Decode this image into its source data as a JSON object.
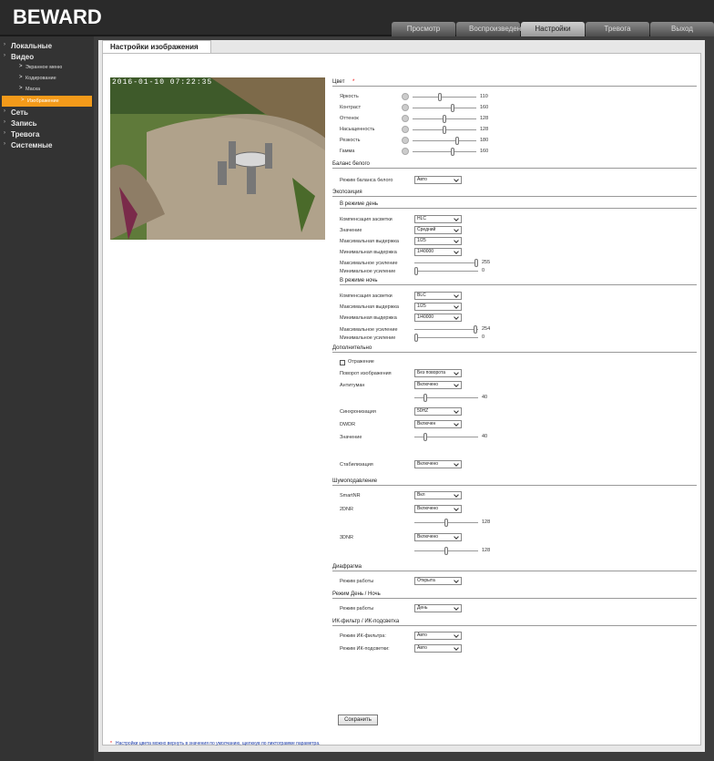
{
  "brand": "BEWARD",
  "tabs": [
    "Просмотр",
    "Воспроизведение",
    "Настройки",
    "Тревога",
    "Выход"
  ],
  "sidebar": [
    {
      "label": "Локальные",
      "level": "top"
    },
    {
      "label": "Видео",
      "level": "top"
    },
    {
      "label": "Экранное меню",
      "level": "sub"
    },
    {
      "label": "Кодирование",
      "level": "sub"
    },
    {
      "label": "Маска",
      "level": "sub"
    },
    {
      "label": "Изображение",
      "level": "sub",
      "selected": true
    },
    {
      "label": "Сеть",
      "level": "top"
    },
    {
      "label": "Запись",
      "level": "top"
    },
    {
      "label": "Тревога",
      "level": "top"
    },
    {
      "label": "Системные",
      "level": "top"
    }
  ],
  "page_tab": "Настройки изображения",
  "camera_timestamp": "2016-01-10 07:22:35",
  "color": {
    "title": "Цвет",
    "req": "*",
    "items": [
      {
        "label": "Яркость",
        "value": "110",
        "pos": 0.43
      },
      {
        "label": "Контраст",
        "value": "160",
        "pos": 0.63
      },
      {
        "label": "Оттенок",
        "value": "128",
        "pos": 0.5
      },
      {
        "label": "Насыщенность",
        "value": "128",
        "pos": 0.5
      },
      {
        "label": "Резкость",
        "value": "180",
        "pos": 0.71
      },
      {
        "label": "Гамма",
        "value": "160",
        "pos": 0.63
      }
    ]
  },
  "wb": {
    "title": "Баланс белого",
    "label": "Режим баланса белого",
    "value": "Авто"
  },
  "exposure": {
    "title": "Экспозиция",
    "day_title": "В режиме день",
    "day": [
      {
        "label": "Компенсация засветки",
        "value": "HLC"
      },
      {
        "label": "Значение",
        "value": "Средний"
      },
      {
        "label": "Максимальная выдержка",
        "value": "1/25"
      },
      {
        "label": "Минимальная выдержка",
        "value": "1/40000"
      }
    ],
    "day_sliders": [
      {
        "label": "Максимальное усиление",
        "value": "255",
        "pos": 1.0
      },
      {
        "label": "Минимальное усиление",
        "value": "0",
        "pos": 0.0
      }
    ],
    "night_title": "В режиме ночь",
    "night": [
      {
        "label": "Компенсация засветки",
        "value": "BLC"
      },
      {
        "label": "Максимальная выдержка",
        "value": "1/25"
      },
      {
        "label": "Минимальная выдержка",
        "value": "1/40000"
      }
    ],
    "night_sliders": [
      {
        "label": "Максимальное усиление",
        "value": "254",
        "pos": 0.99
      },
      {
        "label": "Минимальное усиление",
        "value": "0",
        "pos": 0.0
      }
    ]
  },
  "extra": {
    "title": "Дополнительно",
    "mirror": "Отражение",
    "rotate": {
      "label": "Поворот изображения",
      "value": "Без поворота"
    },
    "antifog": {
      "label": "Антитуман",
      "value": "Включено",
      "slider": "40",
      "pos": 0.15
    },
    "sync": {
      "label": "Синхронизация",
      "value": "50HZ"
    },
    "dwdr": {
      "label": "DWDR",
      "value": "Включен"
    },
    "dwdr_val": {
      "label": "Значение",
      "value": "40",
      "pos": 0.15
    },
    "stab": {
      "label": "Стабилизация",
      "value": "Включено"
    }
  },
  "noise": {
    "title": "Шумоподавление",
    "smartnr": {
      "label": "SmartNR",
      "value": "Вкл"
    },
    "dnr2": {
      "label": "2DNR",
      "value": "Включено",
      "slider": "128",
      "pos": 0.5
    },
    "dnr3": {
      "label": "3DNR",
      "value": "Включено",
      "slider": "128",
      "pos": 0.5
    }
  },
  "iris": {
    "title": "Диафрагма",
    "label": "Режим работы",
    "value": "Открыта"
  },
  "daynight": {
    "title": "Режим День / Ночь",
    "label": "Режим работы",
    "value": "День"
  },
  "ir": {
    "title": "ИК-фильтр / ИК-подсветка",
    "filter": {
      "label": "Режим ИК-фильтра:",
      "value": "Авто"
    },
    "light": {
      "label": "Режим ИК-подсветки:",
      "value": "Авто"
    }
  },
  "save": "Сохранить",
  "note": "Настройки цвета можно вернуть в значения по умолчанию, щелкнув по пиктограмме параметра."
}
